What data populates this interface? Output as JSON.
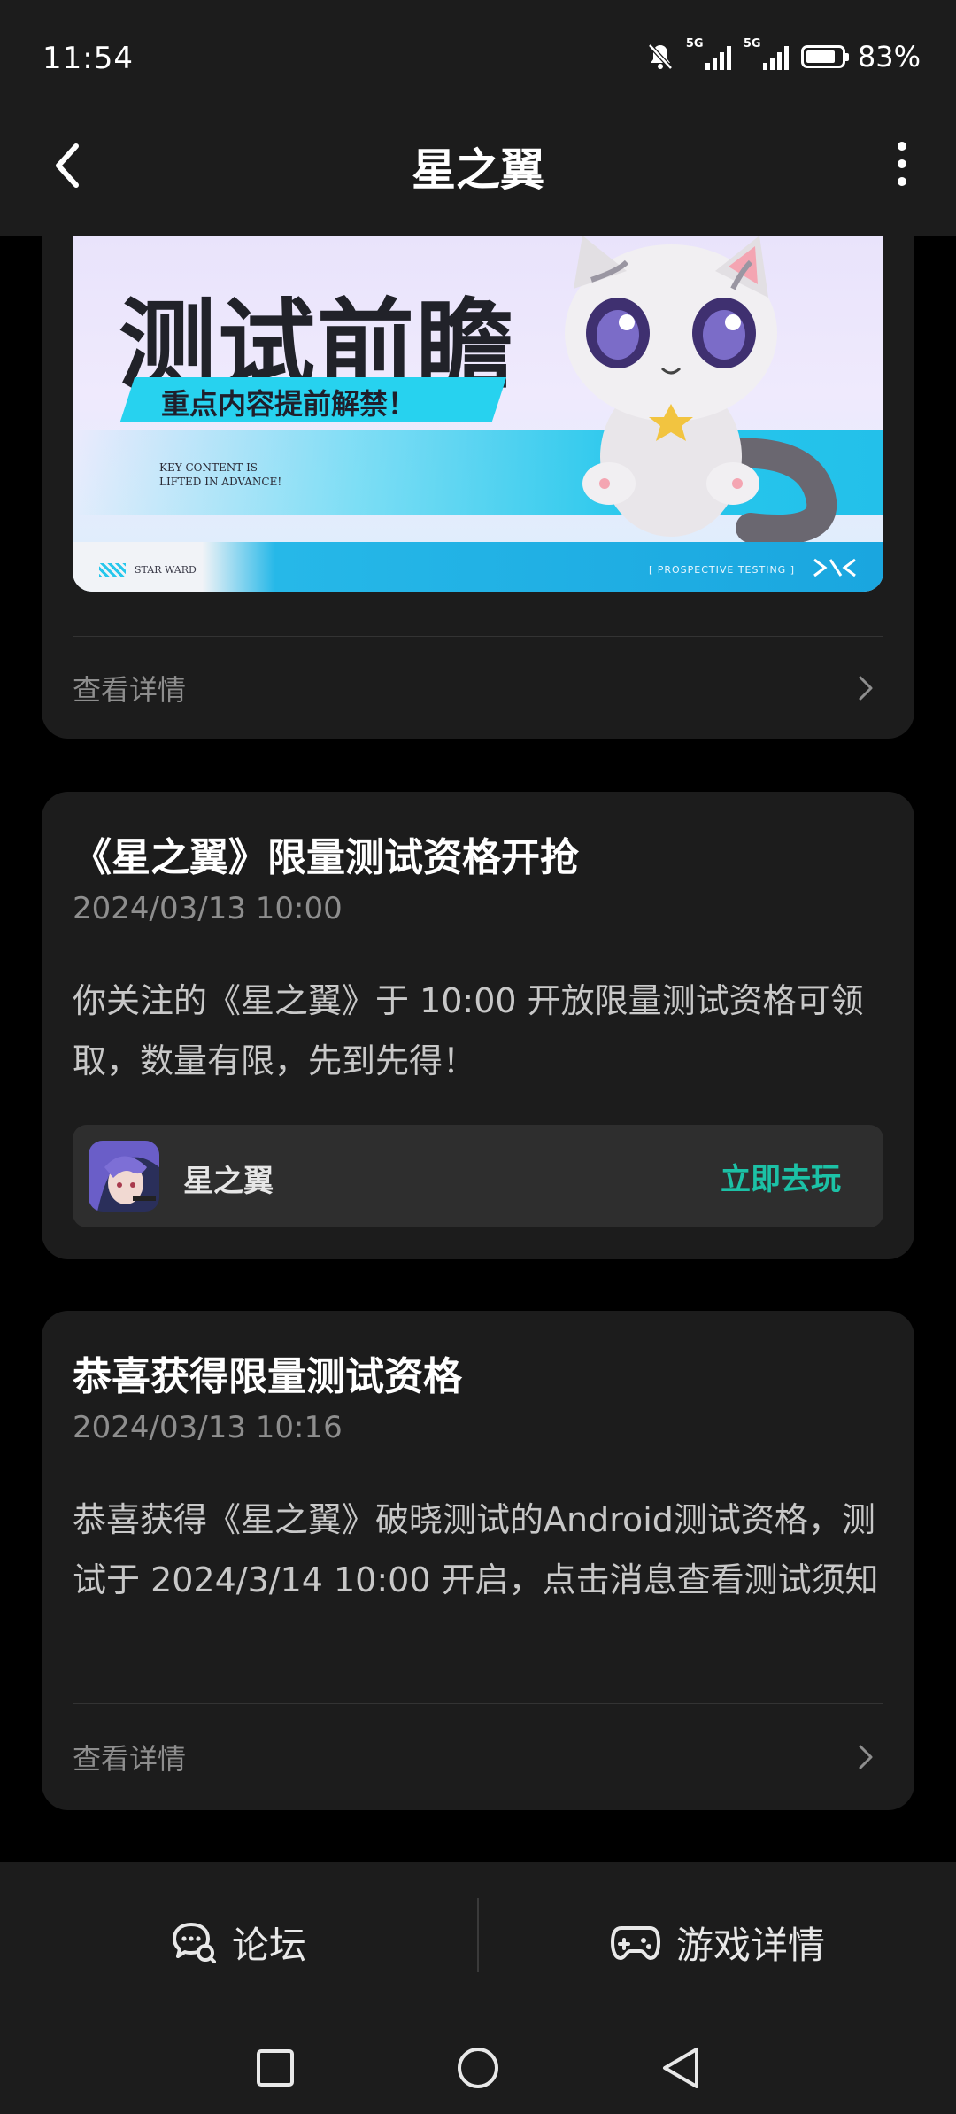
{
  "status_bar": {
    "time": "11:54",
    "network_label_1": "5G",
    "network_label_2": "5G",
    "battery_percent": "83%",
    "battery_level": 0.83
  },
  "app_bar": {
    "title": "星之翼",
    "back_icon": "chevron-left-icon",
    "more_icon": "more-vertical-icon"
  },
  "cards": {
    "banner_card": {
      "banner": {
        "title": "测试前瞻",
        "ribbon": "重点内容提前解禁！",
        "subtitle": "KEY CONTENT IS LIFTED IN ADVANCE!",
        "footer_left": "STAR WARD",
        "footer_right": "[ PROSPECTIVE TESTING ]"
      },
      "detail_label": "查看详情"
    },
    "test_open_card": {
      "title": "《星之翼》限量测试资格开抢",
      "date": "2024/03/13 10:00",
      "body": "你关注的《星之翼》于 10:00 开放限量测试资格可领取，数量有限，先到先得！",
      "game_name": "星之翼",
      "play_label": "立即去玩"
    },
    "congrats_card": {
      "title": "恭喜获得限量测试资格",
      "date": "2024/03/13 10:16",
      "body": "恭喜获得《星之翼》破晓测试的Android测试资格，测试于 2024/3/14 10:00 开启，点击消息查看测试须知",
      "detail_label": "查看详情"
    }
  },
  "tabbar": {
    "forum_label": "论坛",
    "game_detail_label": "游戏详情"
  },
  "colors": {
    "accent": "#1cc1a6",
    "card_bg": "#1c1c1c",
    "page_bg": "#000000"
  }
}
